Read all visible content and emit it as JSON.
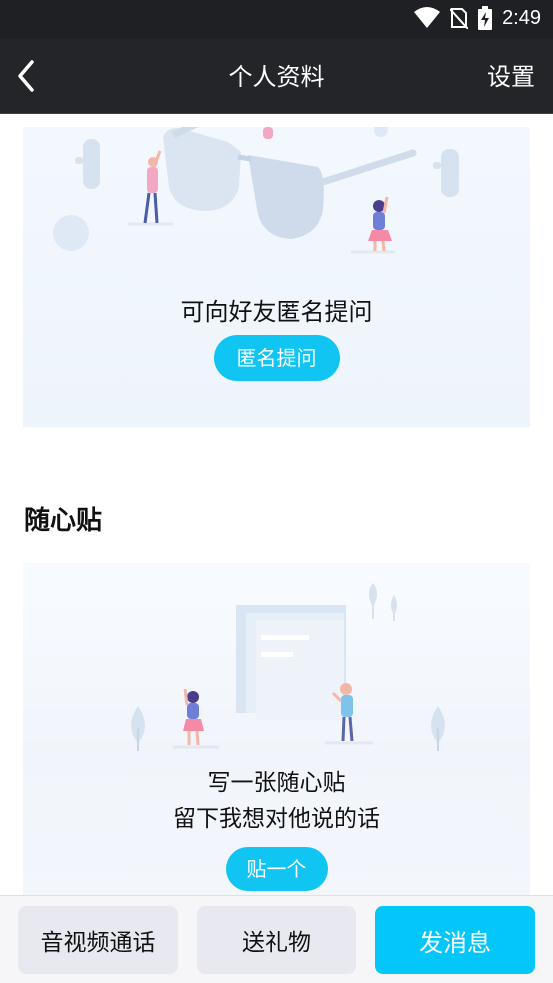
{
  "status": {
    "time": "2:49"
  },
  "header": {
    "title": "个人资料",
    "settings_label": "设置"
  },
  "anon": {
    "prompt": "可向好友匿名提问",
    "button_label": "匿名提问"
  },
  "sticky": {
    "section_title": "随心贴",
    "line1": "写一张随心贴",
    "line2": "留下我想对他说的话",
    "button_label": "贴一个"
  },
  "actions": {
    "av_call": "音视频通话",
    "gift": "送礼物",
    "message": "发消息"
  },
  "colors": {
    "accent": "#04c6f8",
    "bar": "#232529"
  }
}
